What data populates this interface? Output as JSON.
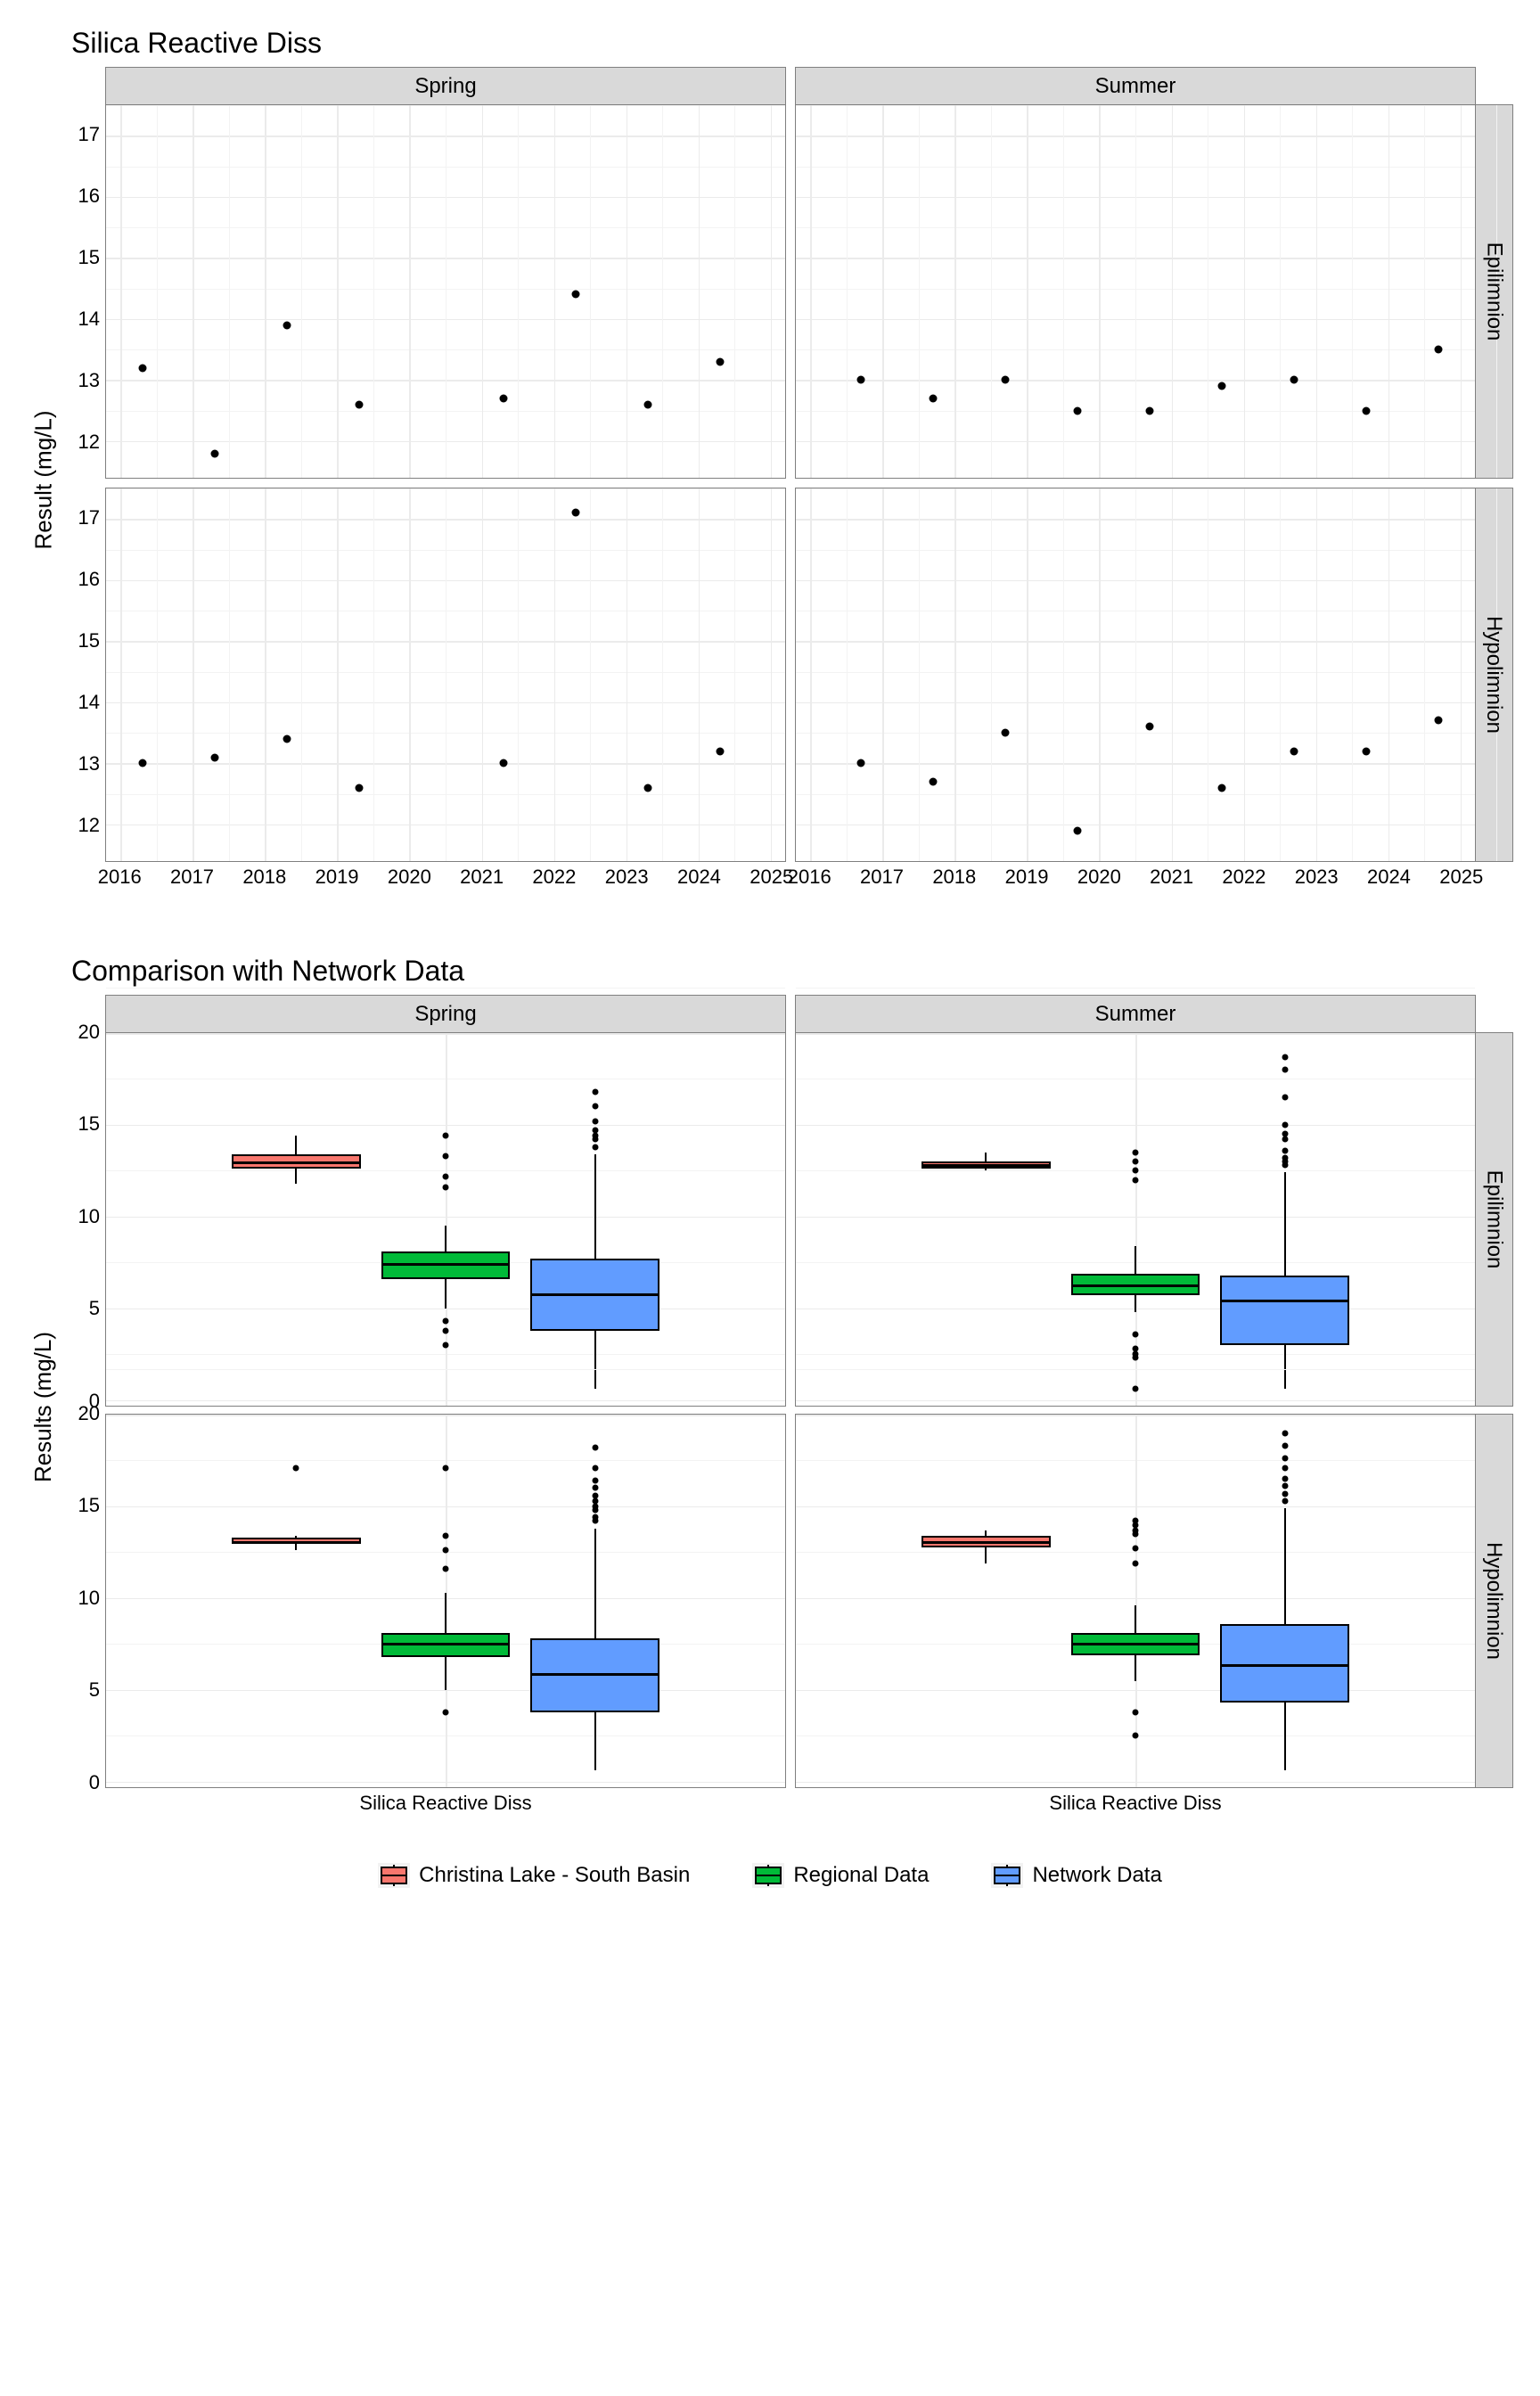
{
  "chart_data": [
    {
      "type": "scatter",
      "title": "Silica Reactive Diss",
      "ylabel": "Result (mg/L)",
      "xlabel": "",
      "x_ticks": [
        2016,
        2017,
        2018,
        2019,
        2020,
        2021,
        2022,
        2023,
        2024,
        2025
      ],
      "y_ticks": [
        12,
        13,
        14,
        15,
        16,
        17
      ],
      "ylim": [
        11.4,
        17.5
      ],
      "xlim": [
        2015.8,
        2025.2
      ],
      "facet_cols": [
        "Spring",
        "Summer"
      ],
      "facet_rows": [
        "Epilimnion",
        "Hypolimnion"
      ],
      "panels": {
        "Spring_Epilimnion": [
          {
            "x": 2016.3,
            "y": 13.2
          },
          {
            "x": 2017.3,
            "y": 11.8
          },
          {
            "x": 2018.3,
            "y": 13.9
          },
          {
            "x": 2019.3,
            "y": 12.6
          },
          {
            "x": 2021.3,
            "y": 12.7
          },
          {
            "x": 2022.3,
            "y": 14.4
          },
          {
            "x": 2023.3,
            "y": 12.6
          },
          {
            "x": 2024.3,
            "y": 13.3
          }
        ],
        "Summer_Epilimnion": [
          {
            "x": 2016.7,
            "y": 13.0
          },
          {
            "x": 2017.7,
            "y": 12.7
          },
          {
            "x": 2018.7,
            "y": 13.0
          },
          {
            "x": 2019.7,
            "y": 12.5
          },
          {
            "x": 2020.7,
            "y": 12.5
          },
          {
            "x": 2021.7,
            "y": 12.9
          },
          {
            "x": 2022.7,
            "y": 13.0
          },
          {
            "x": 2023.7,
            "y": 12.5
          },
          {
            "x": 2024.7,
            "y": 13.5
          }
        ],
        "Spring_Hypolimnion": [
          {
            "x": 2016.3,
            "y": 13.0
          },
          {
            "x": 2017.3,
            "y": 13.1
          },
          {
            "x": 2018.3,
            "y": 13.4
          },
          {
            "x": 2019.3,
            "y": 12.6
          },
          {
            "x": 2021.3,
            "y": 13.0
          },
          {
            "x": 2022.3,
            "y": 17.1
          },
          {
            "x": 2023.3,
            "y": 12.6
          },
          {
            "x": 2024.3,
            "y": 13.2
          }
        ],
        "Summer_Hypolimnion": [
          {
            "x": 2016.7,
            "y": 13.0
          },
          {
            "x": 2017.7,
            "y": 12.7
          },
          {
            "x": 2018.7,
            "y": 13.5
          },
          {
            "x": 2019.7,
            "y": 11.9
          },
          {
            "x": 2020.7,
            "y": 13.6
          },
          {
            "x": 2021.7,
            "y": 12.6
          },
          {
            "x": 2022.7,
            "y": 13.2
          },
          {
            "x": 2023.7,
            "y": 13.2
          },
          {
            "x": 2024.7,
            "y": 13.7
          }
        ]
      }
    },
    {
      "type": "boxplot",
      "title": "Comparison with Network Data",
      "ylabel": "Results (mg/L)",
      "xlabel": "Silica Reactive Diss",
      "y_ticks": [
        0,
        5,
        10,
        15,
        20
      ],
      "ylim": [
        -0.3,
        20
      ],
      "facet_cols": [
        "Spring",
        "Summer"
      ],
      "facet_rows": [
        "Epilimnion",
        "Hypolimnion"
      ],
      "x_category": "Silica Reactive Diss",
      "series": [
        "Christina Lake - South Basin",
        "Regional Data",
        "Network Data"
      ],
      "colors": {
        "Christina Lake - South Basin": "#F8766D",
        "Regional Data": "#00BA38",
        "Network Data": "#619CFF"
      },
      "panels": {
        "Spring_Epilimnion": {
          "Christina Lake - South Basin": {
            "lw": 11.8,
            "q1": 12.6,
            "med": 13.0,
            "q3": 13.4,
            "uw": 14.4,
            "out": []
          },
          "Regional Data": {
            "lw": 5.0,
            "q1": 6.6,
            "med": 7.5,
            "q3": 8.1,
            "uw": 9.5,
            "out": [
              3.0,
              3.8,
              4.3,
              11.6,
              12.2,
              13.3,
              14.4
            ]
          },
          "Network Data": {
            "lw": 0.6,
            "q1": 3.8,
            "med": 5.8,
            "q3": 7.7,
            "uw": 13.4,
            "out": [
              13.8,
              14.2,
              14.4,
              14.7,
              15.2,
              16.0,
              16.8
            ]
          }
        },
        "Summer_Epilimnion": {
          "Christina Lake - South Basin": {
            "lw": 12.5,
            "q1": 12.6,
            "med": 12.9,
            "q3": 13.0,
            "uw": 13.5,
            "out": []
          },
          "Regional Data": {
            "lw": 4.8,
            "q1": 5.7,
            "med": 6.3,
            "q3": 6.9,
            "uw": 8.4,
            "out": [
              0.6,
              2.3,
              2.5,
              2.8,
              3.6,
              12.0,
              12.5,
              13.0,
              13.5
            ]
          },
          "Network Data": {
            "lw": 0.6,
            "q1": 3.0,
            "med": 5.5,
            "q3": 6.8,
            "uw": 12.4,
            "out": [
              12.8,
              13.0,
              13.2,
              13.6,
              14.2,
              14.5,
              15.0,
              16.5,
              18.0,
              18.7
            ]
          }
        },
        "Spring_Hypolimnion": {
          "Christina Lake - South Basin": {
            "lw": 12.6,
            "q1": 12.95,
            "med": 13.05,
            "q3": 13.3,
            "uw": 13.4,
            "out": [
              17.1
            ]
          },
          "Regional Data": {
            "lw": 5.0,
            "q1": 6.8,
            "med": 7.6,
            "q3": 8.1,
            "uw": 10.3,
            "out": [
              3.8,
              11.6,
              12.6,
              13.4,
              17.1
            ]
          },
          "Network Data": {
            "lw": 0.6,
            "q1": 3.8,
            "med": 5.9,
            "q3": 7.8,
            "uw": 13.8,
            "out": [
              14.2,
              14.4,
              14.8,
              15.0,
              15.3,
              15.6,
              16.0,
              16.4,
              17.1,
              18.2
            ]
          }
        },
        "Summer_Hypolimnion": {
          "Christina Lake - South Basin": {
            "lw": 11.9,
            "q1": 12.75,
            "med": 13.1,
            "q3": 13.4,
            "uw": 13.7,
            "out": []
          },
          "Regional Data": {
            "lw": 5.5,
            "q1": 6.9,
            "med": 7.6,
            "q3": 8.1,
            "uw": 9.6,
            "out": [
              2.5,
              3.8,
              11.9,
              12.7,
              13.5,
              13.7,
              14.0,
              14.2
            ]
          },
          "Network Data": {
            "lw": 0.6,
            "q1": 4.3,
            "med": 6.4,
            "q3": 8.6,
            "uw": 14.9,
            "out": [
              15.3,
              15.7,
              16.1,
              16.5,
              17.1,
              17.6,
              18.3,
              19.0
            ]
          }
        }
      }
    }
  ],
  "legend": {
    "items": [
      "Christina Lake - South Basin",
      "Regional Data",
      "Network Data"
    ]
  }
}
